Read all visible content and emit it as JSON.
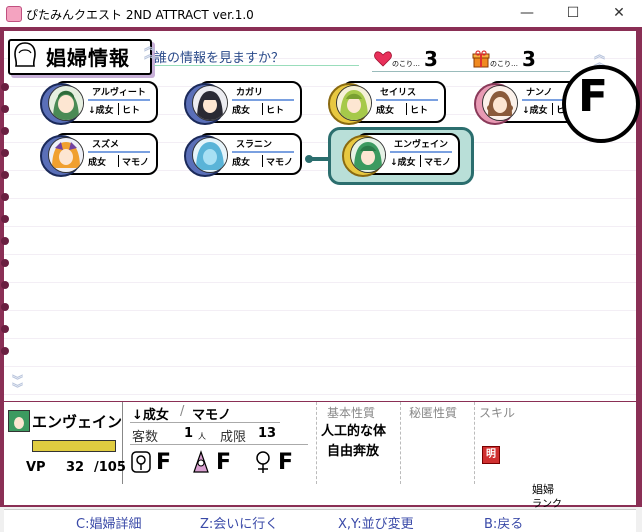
{
  "window": {
    "title": "ぴたみんクエスト 2ND ATTRACT ver.1.0"
  },
  "header": {
    "title": "娼婦情報",
    "question": "誰の情報を見ますか？"
  },
  "counters": [
    {
      "icon": "heart-icon",
      "label": "のこり…",
      "value": "3"
    },
    {
      "icon": "gift-icon",
      "label": "のこり…",
      "value": "3"
    }
  ],
  "cards": [
    {
      "name": "アルヴィート",
      "age": "↓成女",
      "race": "ヒト",
      "ring": "blue"
    },
    {
      "name": "カガリ",
      "age": "成女",
      "race": "ヒト",
      "ring": "blue"
    },
    {
      "name": "セイリス",
      "age": "成女",
      "race": "ヒト",
      "ring": "gold"
    },
    {
      "name": "ナンノ",
      "age": "↓成女",
      "race": "ヒト",
      "ring": "pink"
    },
    {
      "name": "スズメ",
      "age": "成女",
      "race": "マモノ",
      "ring": "blue"
    },
    {
      "name": "スラニン",
      "age": "成女",
      "race": "マモノ",
      "ring": "blue"
    },
    {
      "name": "エンヴェイン",
      "age": "↓成女",
      "race": "マモノ",
      "ring": "gold"
    }
  ],
  "selected": {
    "name": "エンヴェイン",
    "vp_label": "VP",
    "vp": "32",
    "vp_max": "/105",
    "vp_fraction": 0.3,
    "age": "↓成女",
    "race": "マモノ",
    "customers_label": "客数",
    "customers": "1",
    "customers_unit": "人",
    "limit_label": "成限",
    "limit": "13",
    "grades": [
      "F",
      "F",
      "F"
    ],
    "basic_trait_label": "基本性質",
    "basic_traits": [
      "人工的な体",
      "自由奔放"
    ],
    "secret_trait_label": "秘匿性質",
    "skill_label": "スキル",
    "skill_icon": "明",
    "rank_label_1": "娼婦",
    "rank_label_2": "ランク",
    "rank": "F"
  },
  "help": {
    "c": "C:娼婦詳細",
    "z": "Z:会いに行く",
    "xy": "X,Y:並び変更",
    "b": "B:戻る"
  },
  "colors": {
    "frame": "#8a2f55",
    "highlight": "#2b6e6e",
    "help_text": "#3a4aa8"
  }
}
